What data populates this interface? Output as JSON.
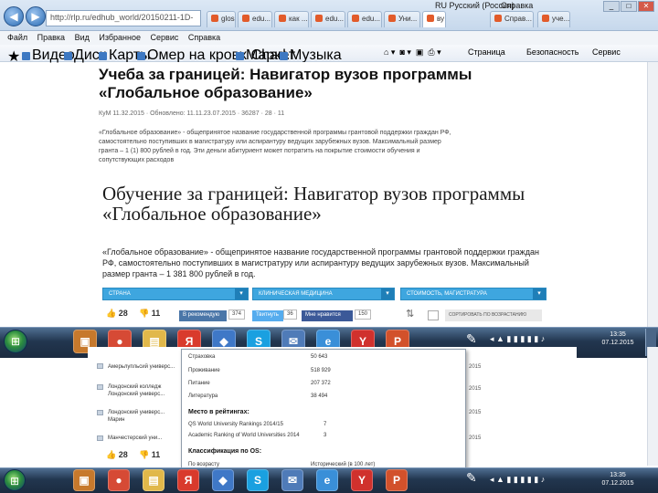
{
  "browser": {
    "url": "http://rlp.ru/edhub_world/20150211-1D-",
    "tabs": [
      "gloss",
      "edu...",
      "как ...",
      "edu...",
      "edu...",
      "Уни...",
      "ву",
      "Справ...",
      "уче..."
    ],
    "language": "RU Русский (Россия)",
    "help_label": "Справка",
    "menu": [
      "Файл",
      "Правка",
      "Вид",
      "Избранное",
      "Сервис",
      "Справка"
    ],
    "favorites": [
      "Видео",
      "Диск",
      "Карты",
      "Омер на кровх Charl...",
      "Маркет",
      "Музыка"
    ],
    "tools": [
      "Страница",
      "Безопасность",
      "Сервис"
    ]
  },
  "article": {
    "title": "Учеба за границей: Навигатор вузов программы «Глобальное образование»",
    "meta": "КуМ 11.32.2015 · Обновлено: 11.11.23.07.2015 · 36287 · 28 · 11",
    "lead": "«Глобальное образование» - общепринятое название государственной программы грантовой поддержки граждан РФ, самостоятельно поступивших в магистратуру или аспирантуру ведущих зарубежных вузов. Максимальный размер гранта – 1 (1) 800 рублей в год. Эти деньги абитуриент может потратить на покрытие стоимости обучения и сопутствующих расходов",
    "image_title": "Обучение за границей: Навигатор вузов программы «Глобальное образование»",
    "image_lead": "«Глобальное образование» - общепринятое название государственной программы грантовой поддержки граждан РФ, самостоятельно поступивших в магистратуру или аспирантуру ведущих зарубежных вузов. Максимальный размер гранта – 1 381 800 рублей в год."
  },
  "filters": [
    {
      "label": "СТРАНА"
    },
    {
      "label": "КЛИНИЧЕСКАЯ МЕДИЦИНА"
    },
    {
      "label": "СТОИМОСТЬ, МАГИСТРАТУРА"
    }
  ],
  "votes": {
    "up": "28",
    "down": "11"
  },
  "social": [
    {
      "label": "В рекомендую",
      "count": "374",
      "color": "#4a76a8"
    },
    {
      "label": "Твитнуть",
      "count": "36",
      "color": "#55acee"
    },
    {
      "label": "Мне нравится",
      "count": "150",
      "color": "#3b5998"
    }
  ],
  "sort_label": "СОРТИРОВАТЬ ПО ВОЗРАСТАНИЮ",
  "taskbar": {
    "icons": [
      {
        "name": "lock-folder-icon",
        "glyph": "▣",
        "color": "#c7792c"
      },
      {
        "name": "chrome-icon",
        "glyph": "●",
        "color": "#d64a35"
      },
      {
        "name": "explorer-icon",
        "glyph": "▤",
        "color": "#e1b84a"
      },
      {
        "name": "yandex-icon",
        "glyph": "Я",
        "color": "#d93a2c"
      },
      {
        "name": "media-icon",
        "glyph": "◆",
        "color": "#3f78c7"
      },
      {
        "name": "skype-icon",
        "glyph": "S",
        "color": "#1aa0e0"
      },
      {
        "name": "mail-icon",
        "glyph": "✉",
        "color": "#4f7bb8"
      },
      {
        "name": "ie-icon",
        "glyph": "e",
        "color": "#3a8fd8"
      },
      {
        "name": "yandex-browser-icon",
        "glyph": "Y",
        "color": "#d0312d"
      },
      {
        "name": "powerpoint-icon",
        "glyph": "P",
        "color": "#d2512b"
      }
    ],
    "clock_time": "13:35",
    "clock_date": "07.12.2015"
  },
  "lower_list": [
    {
      "name": "Амерьлупльсий универс..."
    },
    {
      "name": "Лондонский колледж\nЛондонский универс..."
    },
    {
      "name": "Лондонский универс...\nМарин"
    },
    {
      "name": "Манчестерский уни..."
    }
  ],
  "popup": {
    "rows": [
      {
        "label": "Страховка",
        "value": "50 643"
      },
      {
        "label": "Проживание",
        "value": "518 929"
      },
      {
        "label": "Питание",
        "value": "207 372"
      },
      {
        "label": "Литература",
        "value": "38 494"
      }
    ],
    "ratings_heading": "Место в рейтингах:",
    "ratings": [
      {
        "label": "QS World University Rankings 2014/15",
        "value": "7"
      },
      {
        "label": "Academic Ranking of World Universities 2014",
        "value": "3"
      }
    ],
    "classification_heading": "Классификация по OS:",
    "classification": [
      {
        "label": "По возрасту",
        "value": "Исторический (в 100 лет)"
      }
    ]
  },
  "lower_years": [
    "2015",
    "2015",
    "2015",
    "2015"
  ],
  "lower_votes": {
    "up": "28",
    "down": "11"
  }
}
